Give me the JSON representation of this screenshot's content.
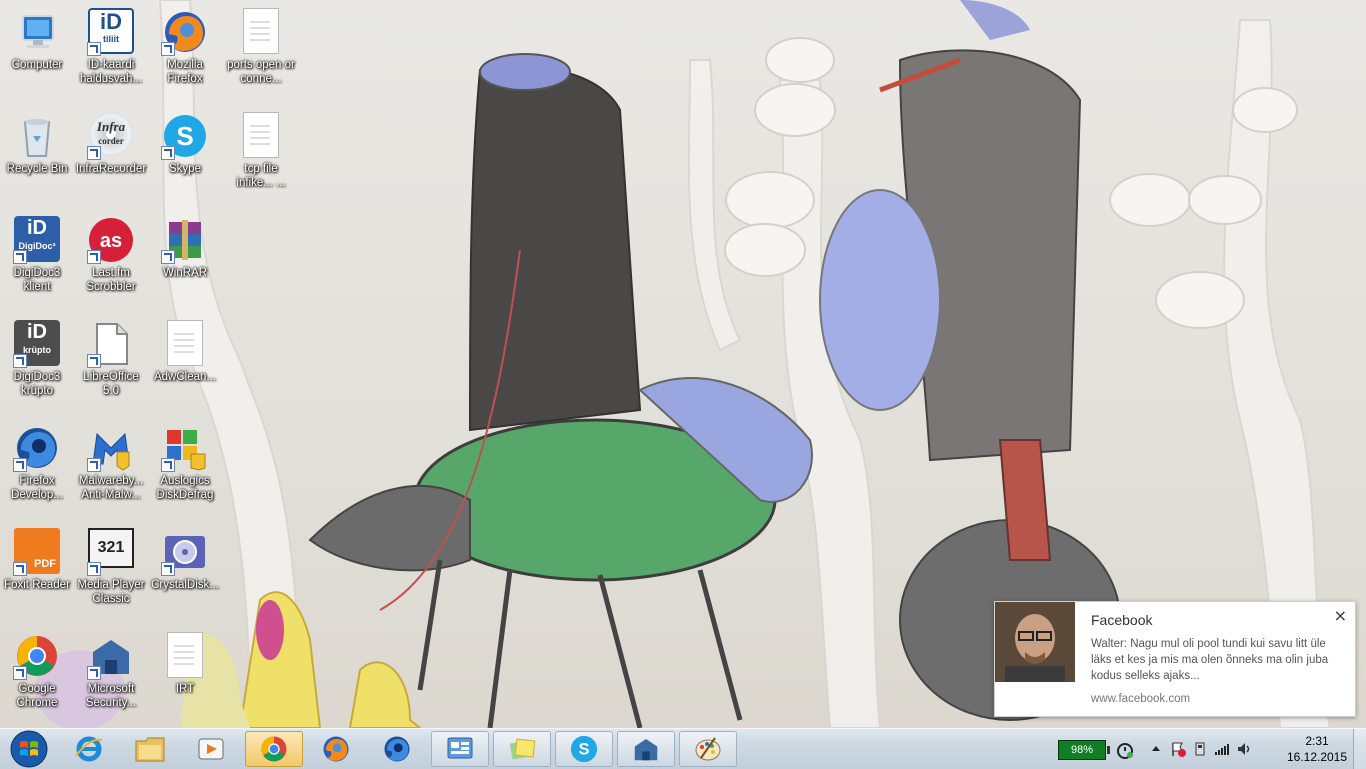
{
  "desktop": {
    "icons": [
      {
        "label": "Computer"
      },
      {
        "label": "ID-kaardi haldusvah..."
      },
      {
        "label": "Mozilla Firefox"
      },
      {
        "label": "ports open or conne..."
      },
      {
        "label": "Recycle Bin"
      },
      {
        "label": "InfraRecorder"
      },
      {
        "label": "Skype"
      },
      {
        "label": "tcp file infike... ..."
      },
      {
        "label": "DigiDoc3 klient"
      },
      {
        "label": "Last.fm Scrobbler"
      },
      {
        "label": "WinRAR"
      },
      {
        "label": "DigiDoc3 krüpto"
      },
      {
        "label": "LibreOffice 5.0"
      },
      {
        "label": "AdwClean..."
      },
      {
        "label": "Firefox Develop..."
      },
      {
        "label": "Malwareby... Anti-Malw..."
      },
      {
        "label": "Auslogics DiskDefrag"
      },
      {
        "label": "Foxit Reader"
      },
      {
        "label": "Media Player Classic"
      },
      {
        "label": "CrystalDisk..."
      },
      {
        "label": "Google Chrome"
      },
      {
        "label": "Microsoft Security..."
      },
      {
        "label": "IRT"
      }
    ],
    "icon_texts": {
      "idcard": "iD",
      "idcard_sub": "tiliit",
      "infra": "Infra",
      "infra_sub": "corder",
      "digidoc": "iD",
      "digidoc_sub": "DigiDoc³",
      "krypto": "iD",
      "krypto_sub": "krüpto",
      "foxit_sub": "PDF",
      "mpc_sub": "321"
    }
  },
  "taskbar": {
    "buttons": [
      {
        "name": "internet-explorer"
      },
      {
        "name": "windows-explorer"
      },
      {
        "name": "media-player"
      },
      {
        "name": "google-chrome",
        "state": "active"
      },
      {
        "name": "firefox"
      },
      {
        "name": "firefox-developer"
      },
      {
        "name": "control-panel",
        "state": "open"
      },
      {
        "name": "sticky-notes",
        "state": "open"
      },
      {
        "name": "skype",
        "state": "open"
      },
      {
        "name": "microsoft-security",
        "state": "open"
      },
      {
        "name": "paint",
        "state": "open"
      }
    ],
    "tray": {
      "battery": "98%",
      "time": "2:31",
      "date": "16.12.2015"
    }
  },
  "notification": {
    "title": "Facebook",
    "body": "Walter: Nagu mul oli pool tundi kui savu litt üle läks et kes ja mis ma olen õnneks ma olin juba kodus selleks ajaks...",
    "source": "www.facebook.com",
    "close": "×"
  },
  "colors": {
    "taskbar": "#c9d5e0",
    "battery": "#0f7f26",
    "active_button": "#f2c96a",
    "label_text": "#ffffff"
  }
}
